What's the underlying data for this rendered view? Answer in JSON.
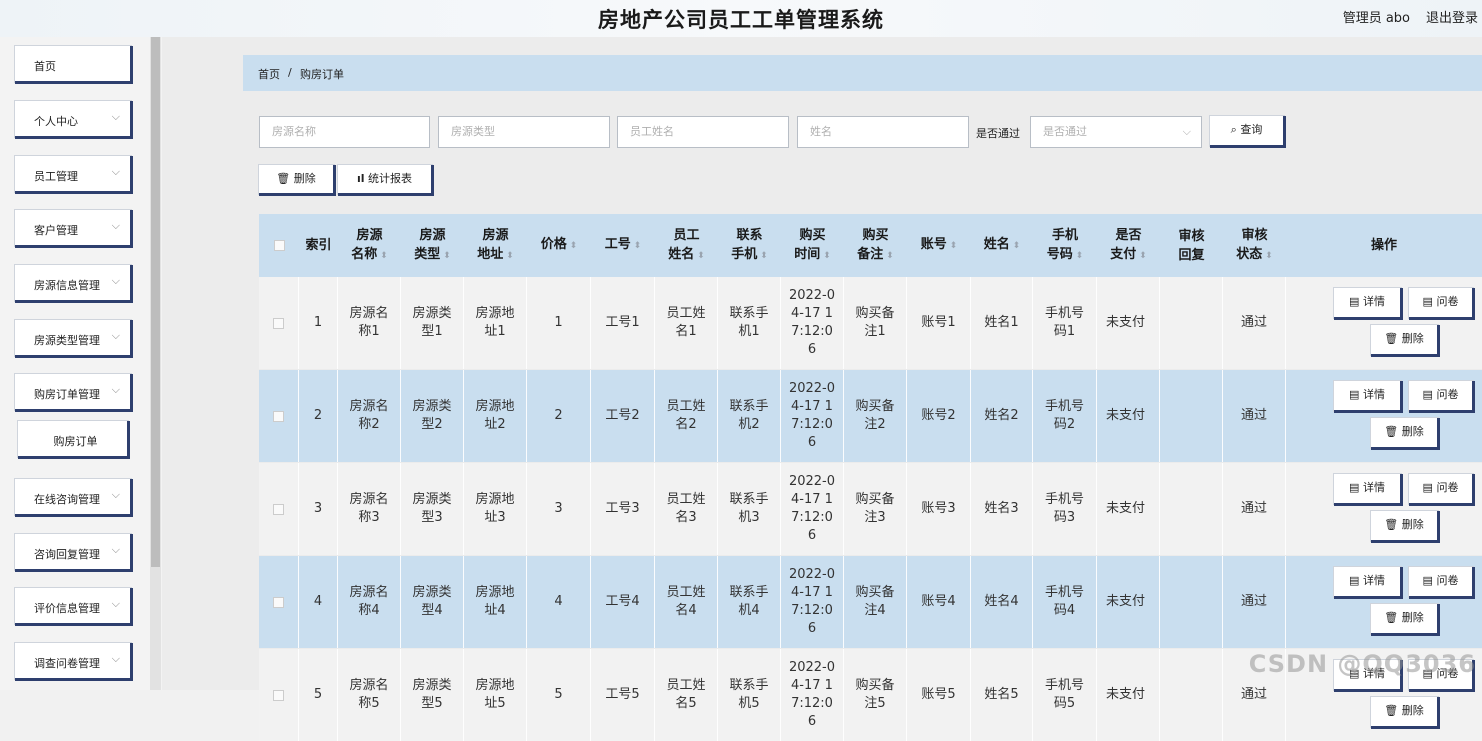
{
  "header": {
    "title": "房地产公司员工工单管理系统",
    "admin": "管理员 abo",
    "logout": "退出登录"
  },
  "sidebar": {
    "items": [
      {
        "label": "首页",
        "chev": ""
      },
      {
        "label": "个人中心",
        "chev": "⌵"
      },
      {
        "label": "员工管理",
        "chev": "⌵"
      },
      {
        "label": "客户管理",
        "chev": "⌵"
      },
      {
        "label": "房源信息管理",
        "chev": "⌵"
      },
      {
        "label": "房源类型管理",
        "chev": "⌵"
      },
      {
        "label": "购房订单管理",
        "chev": "⌵"
      },
      {
        "label": "购房订单",
        "chev": ""
      },
      {
        "label": "在线咨询管理",
        "chev": "⌵"
      },
      {
        "label": "咨询回复管理",
        "chev": "⌵"
      },
      {
        "label": "评价信息管理",
        "chev": "⌵"
      },
      {
        "label": "调查问卷管理",
        "chev": "⌵"
      }
    ]
  },
  "breadcrumb": {
    "home": "首页",
    "sep": "/",
    "current": "购房订单"
  },
  "search": {
    "placeholders": [
      "房源名称",
      "房源类型",
      "员工姓名",
      "姓名"
    ],
    "pass_label": "是否通过",
    "pass_placeholder": "是否通过",
    "query_button": "查询"
  },
  "toolbar": {
    "delete": "删除",
    "report": "统计报表"
  },
  "table": {
    "headers": [
      "索引",
      "房源名称",
      "房源类型",
      "房源地址",
      "价格",
      "工号",
      "员工姓名",
      "联系手机",
      "购买时间",
      "购买备注",
      "账号",
      "姓名",
      "手机号码",
      "是否支付",
      "审核回复",
      "审核状态",
      "操作"
    ],
    "actions": {
      "detail": "详情",
      "survey": "问卷",
      "delete": "删除"
    },
    "rows": [
      {
        "index": "1",
        "name": "房源名称1",
        "type": "房源类型1",
        "addr": "房源地址1",
        "price": "1",
        "no": "工号1",
        "emp": "员工姓名1",
        "phone": "联系手机1",
        "time": "2022-04-17 17:12:06",
        "note": "购买备注1",
        "account": "账号1",
        "person": "姓名1",
        "mobile": "手机号码1",
        "paid": "未支付",
        "reply": "",
        "status": "通过"
      },
      {
        "index": "2",
        "name": "房源名称2",
        "type": "房源类型2",
        "addr": "房源地址2",
        "price": "2",
        "no": "工号2",
        "emp": "员工姓名2",
        "phone": "联系手机2",
        "time": "2022-04-17 17:12:06",
        "note": "购买备注2",
        "account": "账号2",
        "person": "姓名2",
        "mobile": "手机号码2",
        "paid": "未支付",
        "reply": "",
        "status": "通过"
      },
      {
        "index": "3",
        "name": "房源名称3",
        "type": "房源类型3",
        "addr": "房源地址3",
        "price": "3",
        "no": "工号3",
        "emp": "员工姓名3",
        "phone": "联系手机3",
        "time": "2022-04-17 17:12:06",
        "note": "购买备注3",
        "account": "账号3",
        "person": "姓名3",
        "mobile": "手机号码3",
        "paid": "未支付",
        "reply": "",
        "status": "通过"
      },
      {
        "index": "4",
        "name": "房源名称4",
        "type": "房源类型4",
        "addr": "房源地址4",
        "price": "4",
        "no": "工号4",
        "emp": "员工姓名4",
        "phone": "联系手机4",
        "time": "2022-04-17 17:12:06",
        "note": "购买备注4",
        "account": "账号4",
        "person": "姓名4",
        "mobile": "手机号码4",
        "paid": "未支付",
        "reply": "",
        "status": "通过"
      },
      {
        "index": "5",
        "name": "房源名称5",
        "type": "房源类型5",
        "addr": "房源地址5",
        "price": "5",
        "no": "工号5",
        "emp": "员工姓名5",
        "phone": "联系手机5",
        "time": "2022-04-17 17:12:06",
        "note": "购买备注5",
        "account": "账号5",
        "person": "姓名5",
        "mobile": "手机号码5",
        "paid": "未支付",
        "reply": "",
        "status": "通过"
      }
    ]
  },
  "watermark": "CSDN @QQ3036",
  "colors": {
    "accent": "#2e3f6e",
    "row_alt": "#c9deef",
    "row_base": "#f2f2f2"
  }
}
